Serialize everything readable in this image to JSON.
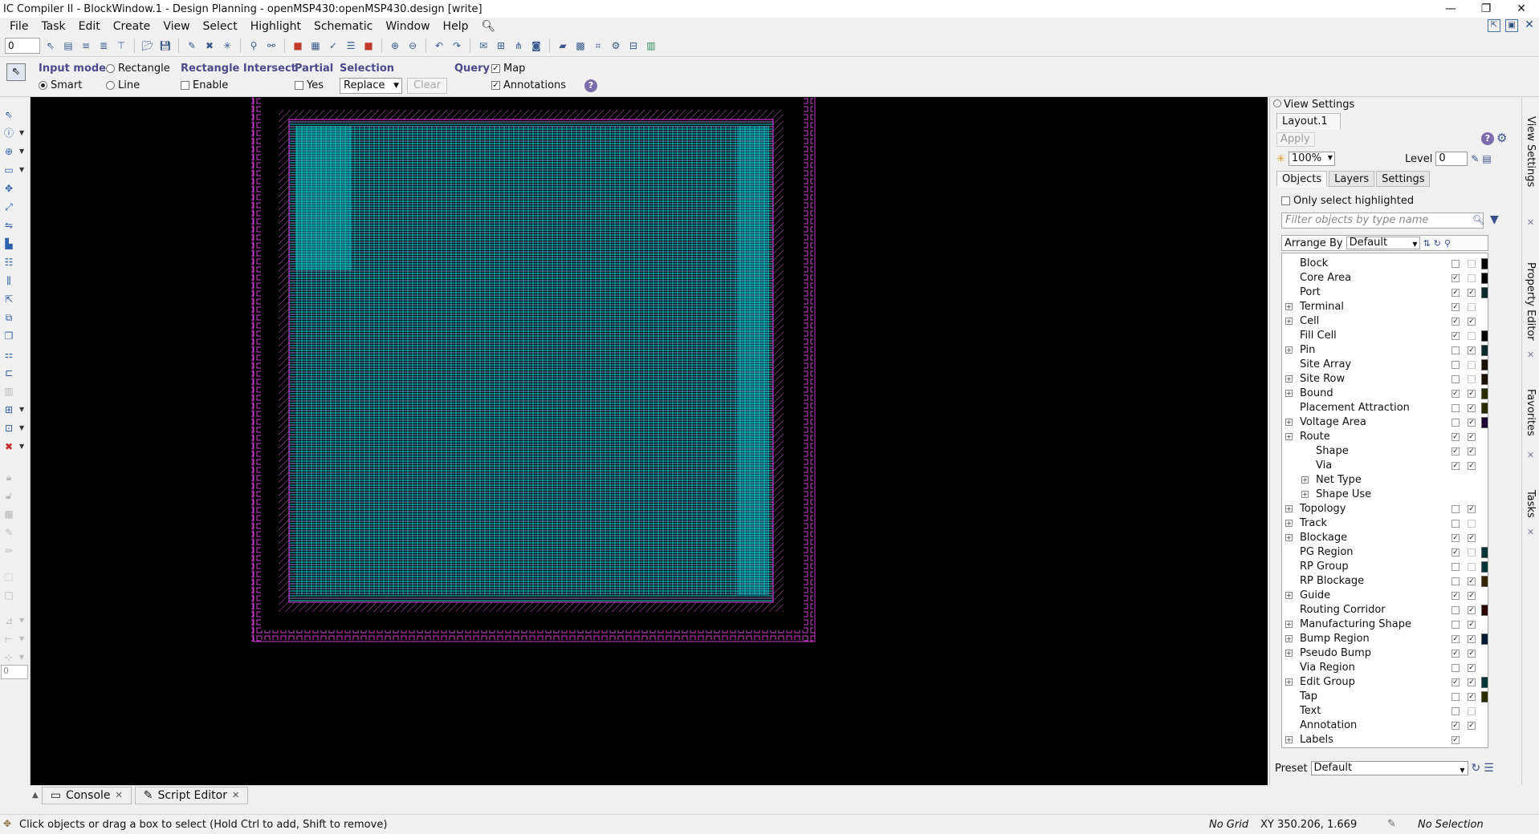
{
  "window": {
    "title": "IC Compiler II - BlockWindow.1 - Design Planning - openMSP430:openMSP430.design [write]",
    "controls": [
      "—",
      "❐",
      "✕"
    ]
  },
  "menubar": {
    "items": [
      "File",
      "Task",
      "Edit",
      "Create",
      "View",
      "Select",
      "Highlight",
      "Schematic",
      "Window",
      "Help"
    ]
  },
  "toolbar": {
    "spinner_value": "0"
  },
  "options": {
    "input_mode_label": "Input mode",
    "mode_smart": "Smart",
    "mode_rectangle": "Rectangle",
    "mode_line": "Line",
    "rect_intersect_label": "Rectangle Intersect",
    "rect_intersect_enable": "Enable",
    "partial_label": "Partial",
    "partial_yes": "Yes",
    "selection_label": "Selection",
    "selection_value": "Replace",
    "clear_label": "Clear",
    "query_label": "Query",
    "query_map": "Map",
    "query_annotations": "Annotations"
  },
  "lefttools": {
    "spinner_value": "0"
  },
  "view_settings": {
    "header": "View Settings",
    "layout_tab": "Layout.1",
    "apply_label": "Apply",
    "zoom_value": "100%",
    "level_label": "Level",
    "level_value": "0",
    "tabs": [
      "Objects",
      "Layers",
      "Settings"
    ],
    "only_select_highlighted": "Only select highlighted",
    "filter_placeholder": "Filter objects by type name",
    "arrange_by_label": "Arrange By",
    "arrange_by_value": "Default",
    "preset_label": "Preset",
    "preset_value": "Default",
    "objects": [
      {
        "label": "Block",
        "exp": false,
        "c1": false,
        "c2": false,
        "swatch": "#000000"
      },
      {
        "label": "Core Area",
        "exp": false,
        "c1": true,
        "c2": false,
        "swatch": "#000000"
      },
      {
        "label": "Port",
        "exp": false,
        "c1": true,
        "c2": true,
        "swatch": "#0a2a2a"
      },
      {
        "label": "Terminal",
        "exp": true,
        "c1": true,
        "c2": false,
        "swatch": ""
      },
      {
        "label": "Cell",
        "exp": true,
        "c1": true,
        "c2": true,
        "swatch": ""
      },
      {
        "label": "Fill Cell",
        "exp": false,
        "c1": true,
        "c2": false,
        "swatch": "#000000"
      },
      {
        "label": "Pin",
        "exp": true,
        "c1": false,
        "c2": true,
        "swatch": "#0a2a2a"
      },
      {
        "label": "Site Array",
        "exp": false,
        "c1": false,
        "c2": false,
        "swatch": "#1a1000"
      },
      {
        "label": "Site Row",
        "exp": true,
        "c1": false,
        "c2": false,
        "swatch": "#1a1000"
      },
      {
        "label": "Bound",
        "exp": true,
        "c1": true,
        "c2": true,
        "swatch": "#2b2b00"
      },
      {
        "label": "Placement Attraction",
        "exp": false,
        "c1": false,
        "c2": true,
        "swatch": "#2b2b00"
      },
      {
        "label": "Voltage Area",
        "exp": true,
        "c1": false,
        "c2": true,
        "swatch": "#1a0033"
      },
      {
        "label": "Route",
        "exp": true,
        "c1": true,
        "c2": true,
        "swatch": ""
      },
      {
        "label": "Shape",
        "sub": true,
        "c1": true,
        "c2": true,
        "swatch": ""
      },
      {
        "label": "Via",
        "sub": true,
        "c1": true,
        "c2": true,
        "swatch": ""
      },
      {
        "label": "Net Type",
        "sub": true,
        "subexp": true,
        "nochk": true,
        "swatch": ""
      },
      {
        "label": "Shape Use",
        "sub": true,
        "subexp": true,
        "nochk": true,
        "swatch": ""
      },
      {
        "label": "Topology",
        "exp": true,
        "c1": false,
        "c2": true,
        "swatch": ""
      },
      {
        "label": "Track",
        "exp": true,
        "c1": false,
        "c2": false,
        "swatch": ""
      },
      {
        "label": "Blockage",
        "exp": true,
        "c1": true,
        "c2": true,
        "swatch": ""
      },
      {
        "label": "PG Region",
        "exp": false,
        "c1": true,
        "c2": false,
        "swatch": "#003333"
      },
      {
        "label": "RP Group",
        "exp": false,
        "c1": false,
        "c2": false,
        "swatch": "#003333"
      },
      {
        "label": "RP Blockage",
        "exp": false,
        "c1": false,
        "c2": true,
        "swatch": "#332200"
      },
      {
        "label": "Guide",
        "exp": true,
        "c1": true,
        "c2": true,
        "swatch": ""
      },
      {
        "label": "Routing Corridor",
        "exp": false,
        "c1": false,
        "c2": true,
        "swatch": "#2b0000"
      },
      {
        "label": "Manufacturing Shape",
        "exp": true,
        "c1": false,
        "c2": true,
        "swatch": ""
      },
      {
        "label": "Bump Region",
        "exp": true,
        "c1": true,
        "c2": true,
        "swatch": "#001a33"
      },
      {
        "label": "Pseudo Bump",
        "exp": true,
        "c1": true,
        "c2": true,
        "swatch": ""
      },
      {
        "label": "Via Region",
        "exp": false,
        "c1": false,
        "c2": true,
        "swatch": ""
      },
      {
        "label": "Edit Group",
        "exp": true,
        "c1": true,
        "c2": true,
        "swatch": "#003333"
      },
      {
        "label": "Tap",
        "exp": false,
        "c1": false,
        "c2": true,
        "swatch": "#2b2b00"
      },
      {
        "label": "Text",
        "exp": false,
        "c1": false,
        "c2": false,
        "swatch": ""
      },
      {
        "label": "Annotation",
        "exp": false,
        "c1": true,
        "c2": true,
        "swatch": ""
      },
      {
        "label": "Labels",
        "exp": true,
        "c1": true,
        "c2null": true,
        "swatch": ""
      }
    ]
  },
  "side_tabs": [
    "View Settings",
    "Property Editor",
    "Favorites",
    "Tasks"
  ],
  "bottom_tabs": [
    "Console",
    "Script Editor"
  ],
  "statusbar": {
    "message": "Click objects or drag a box to select (Hold Ctrl to add, Shift to remove)",
    "grid": "No Grid",
    "xy": "XY 350.206, 1.669",
    "selection": "No Selection"
  },
  "colors": {
    "canvas_bg": "#000000",
    "layout_cyan": "#00e5e5",
    "layout_magenta": "#cc33cc",
    "layout_lavender": "#b9a6e8",
    "label_purple": "#4b4a8a"
  }
}
